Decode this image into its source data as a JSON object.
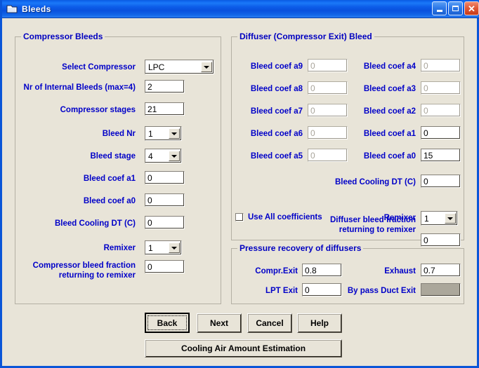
{
  "window": {
    "title": "Bleeds",
    "icon": "window-folder-icon",
    "controls": {
      "minimize": "minimize-icon",
      "maximize": "maximize-icon",
      "close": "close-icon"
    },
    "colors": {
      "titlebar": "#0a55d8",
      "face": "#e8e4d8",
      "label_text": "#0000c8",
      "disabled_text": "#a8a49a",
      "disabled_fill": "#aba79b"
    }
  },
  "compressor_bleeds": {
    "legend": "Compressor Bleeds",
    "fields": [
      {
        "label": "Select Compressor",
        "value": "LPC",
        "kind": "combo",
        "enabled": true
      },
      {
        "label": "Nr of Internal Bleeds (max=4)",
        "value": "2",
        "kind": "text",
        "enabled": true
      },
      {
        "label": "Compressor stages",
        "value": "21",
        "kind": "text",
        "enabled": true
      },
      {
        "label": "Bleed Nr",
        "value": "1",
        "kind": "combo",
        "enabled": true
      },
      {
        "label": "Bleed stage",
        "value": "4",
        "kind": "combo",
        "enabled": true
      },
      {
        "label": "Bleed coef a1",
        "value": "0",
        "kind": "text",
        "enabled": true
      },
      {
        "label": "Bleed coef a0",
        "value": "0",
        "kind": "text",
        "enabled": true
      },
      {
        "label": "Bleed Cooling DT (C)",
        "value": "0",
        "kind": "text",
        "enabled": true
      },
      {
        "label": "Remixer",
        "value": "1",
        "kind": "combo",
        "enabled": true
      },
      {
        "label": "Compressor bleed fraction returning to remixer",
        "label_line1": "Compressor bleed fraction",
        "label_line2": "returning to remixer",
        "value": "0",
        "kind": "text",
        "enabled": true
      }
    ]
  },
  "diffuser_bleed": {
    "legend": "Diffuser (Compressor Exit) Bleed",
    "left_coefs": [
      {
        "label": "Bleed coef a9",
        "value": "0",
        "enabled": false
      },
      {
        "label": "Bleed coef a8",
        "value": "0",
        "enabled": false
      },
      {
        "label": "Bleed coef a7",
        "value": "0",
        "enabled": false
      },
      {
        "label": "Bleed coef a6",
        "value": "0",
        "enabled": false
      },
      {
        "label": "Bleed coef a5",
        "value": "0",
        "enabled": false
      }
    ],
    "right_coefs": [
      {
        "label": "Bleed coef a4",
        "value": "0",
        "enabled": false
      },
      {
        "label": "Bleed coef a3",
        "value": "0",
        "enabled": false
      },
      {
        "label": "Bleed coef a2",
        "value": "0",
        "enabled": false
      },
      {
        "label": "Bleed coef a1",
        "value": "0",
        "enabled": true
      },
      {
        "label": "Bleed coef a0",
        "value": "15",
        "enabled": true
      }
    ],
    "cooling_dt": {
      "label": "Bleed Cooling DT (C)",
      "value": "0"
    },
    "use_all": {
      "label": "Use All coefficients",
      "checked": false
    },
    "remixer": {
      "label": "Remixer",
      "value": "1"
    },
    "fraction": {
      "label_line1": "Diffuser bleed fraction",
      "label_line2": "returning to remixer",
      "value": "0"
    }
  },
  "pressure_recovery": {
    "legend": "Pressure recovery of diffusers",
    "fields": [
      {
        "label": "Compr.Exit",
        "value": "0.8",
        "enabled": true
      },
      {
        "label": "Exhaust",
        "value": "0.7",
        "enabled": true
      },
      {
        "label": "LPT Exit",
        "value": "0",
        "enabled": true
      },
      {
        "label": "By pass Duct Exit",
        "value": "",
        "enabled": false
      }
    ]
  },
  "buttons": {
    "back": "Back",
    "next": "Next",
    "cancel": "Cancel",
    "help": "Help",
    "cooling": "Cooling Air Amount Estimation"
  }
}
